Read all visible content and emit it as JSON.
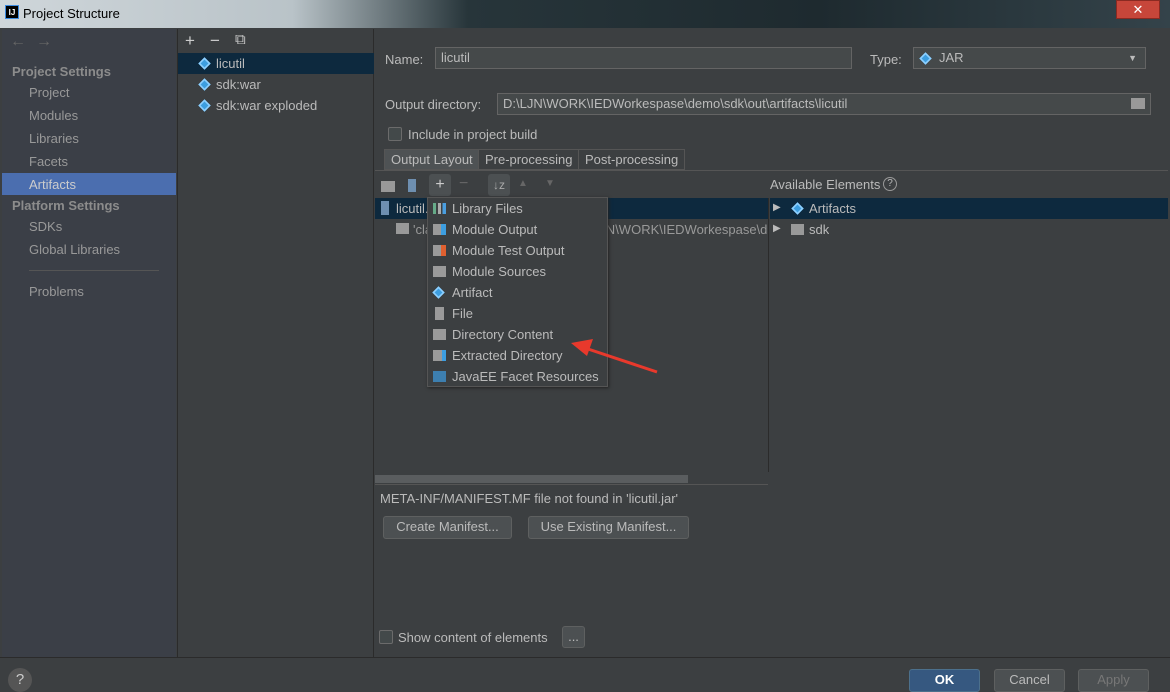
{
  "window": {
    "title": "Project Structure",
    "app_icon": "IJ",
    "close_label": "✕"
  },
  "nav": {
    "back": "←",
    "forward": "→",
    "project_settings_header": "Project Settings",
    "project_settings": [
      "Project",
      "Modules",
      "Libraries",
      "Facets",
      "Artifacts"
    ],
    "platform_settings_header": "Platform Settings",
    "platform_settings": [
      "SDKs",
      "Global Libraries"
    ],
    "problems": "Problems",
    "selected": "Artifacts"
  },
  "artifacts": {
    "toolbar": {
      "add": "+",
      "remove": "−",
      "copy": "⧉"
    },
    "items": [
      {
        "label": "licutil",
        "selected": true
      },
      {
        "label": "sdk:war"
      },
      {
        "label": "sdk:war exploded"
      }
    ]
  },
  "form": {
    "name_label": "Name:",
    "name_value": "licutil",
    "type_label": "Type:",
    "type_value": "JAR",
    "output_label": "Output directory:",
    "output_value": "D:\\LJN\\WORK\\IEDWorkespase\\demo\\sdk\\out\\artifacts\\licutil",
    "include_label": "Include in project build",
    "include_checked": false
  },
  "tabs": [
    {
      "label": "Output Layout",
      "active": true
    },
    {
      "label": "Pre-processing"
    },
    {
      "label": "Post-processing"
    }
  ],
  "layout": {
    "tree": [
      {
        "label": "licutil.jar",
        "selected": true
      },
      {
        "label": "'classes' directory contents (D:\\LJN\\WORK\\IEDWorkespase\\d"
      }
    ],
    "available_label": "Available Elements",
    "available": [
      {
        "label": "Artifacts"
      },
      {
        "label": "sdk"
      }
    ]
  },
  "add_menu": {
    "items": [
      "Library Files",
      "Module Output",
      "Module Test Output",
      "Module Sources",
      "Artifact",
      "File",
      "Directory Content",
      "Extracted Directory",
      "JavaEE Facet Resources"
    ],
    "highlighted_by_arrow": "Directory Content"
  },
  "manifest": {
    "message": "META-INF/MANIFEST.MF file not found in 'licutil.jar'",
    "create": "Create Manifest...",
    "use_existing": "Use Existing Manifest..."
  },
  "show_content": {
    "label": "Show content of elements",
    "checked": false,
    "more": "..."
  },
  "footer": {
    "help": "?",
    "ok": "OK",
    "cancel": "Cancel",
    "apply": "Apply"
  },
  "colors": {
    "selection": "#4b6eaf",
    "tree_selection": "#0d293e",
    "arrow": "#e8392c",
    "ok": "#365880"
  }
}
